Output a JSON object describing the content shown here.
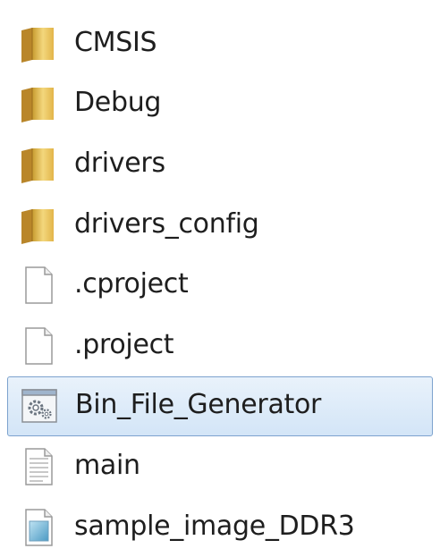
{
  "file_list": {
    "items": [
      {
        "name": "CMSIS",
        "icon": "folder-icon",
        "selected": false
      },
      {
        "name": "Debug",
        "icon": "folder-icon",
        "selected": false
      },
      {
        "name": "drivers",
        "icon": "folder-icon",
        "selected": false
      },
      {
        "name": "drivers_config",
        "icon": "folder-icon",
        "selected": false
      },
      {
        "name": ".cproject",
        "icon": "blank-file-icon",
        "selected": false
      },
      {
        "name": ".project",
        "icon": "blank-file-icon",
        "selected": false
      },
      {
        "name": "Bin_File_Generator",
        "icon": "executable-icon",
        "selected": true
      },
      {
        "name": "main",
        "icon": "text-file-icon",
        "selected": false
      },
      {
        "name": "sample_image_DDR3",
        "icon": "image-file-icon",
        "selected": false
      }
    ]
  },
  "colors": {
    "selection_background": "#d9e8f8",
    "selection_border": "#7da2ce",
    "folder": "#e9c25a",
    "text": "#1e1e1e"
  }
}
